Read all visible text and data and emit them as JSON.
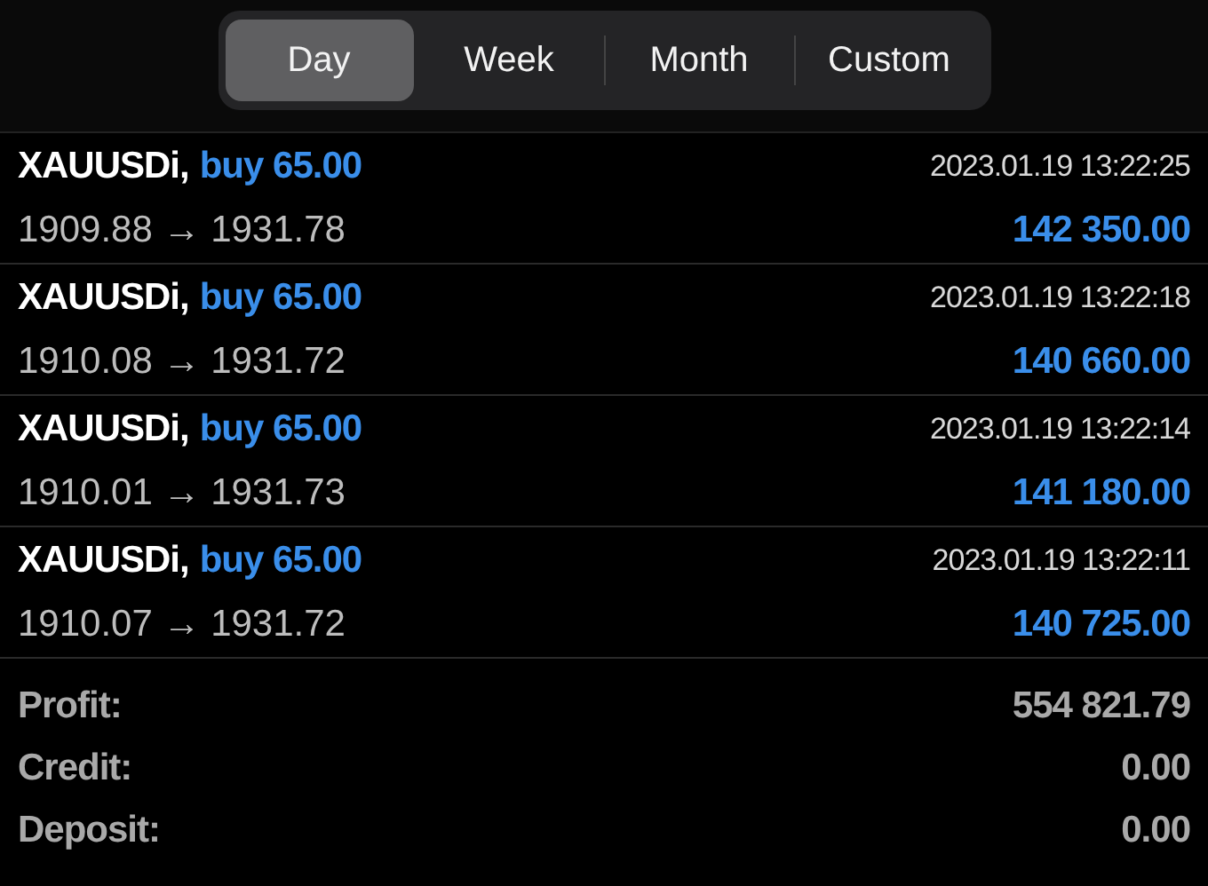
{
  "tabs": [
    {
      "label": "Day",
      "selected": true
    },
    {
      "label": "Week",
      "selected": false
    },
    {
      "label": "Month",
      "selected": false
    },
    {
      "label": "Custom",
      "selected": false
    }
  ],
  "deals": [
    {
      "symbol": "XAUUSDi,",
      "side": "buy 65.00",
      "time": "2023.01.19 13:22:25",
      "prices": "1909.88 → 1931.78",
      "profit": "142 350.00"
    },
    {
      "symbol": "XAUUSDi,",
      "side": "buy 65.00",
      "time": "2023.01.19 13:22:18",
      "prices": "1910.08 → 1931.72",
      "profit": "140 660.00"
    },
    {
      "symbol": "XAUUSDi,",
      "side": "buy 65.00",
      "time": "2023.01.19 13:22:14",
      "prices": "1910.01 → 1931.73",
      "profit": "141 180.00"
    },
    {
      "symbol": "XAUUSDi,",
      "side": "buy 65.00",
      "time": "2023.01.19 13:22:11",
      "prices": "1910.07 → 1931.72",
      "profit": "140 725.00"
    }
  ],
  "summary": [
    {
      "label": "Profit:",
      "value": "554 821.79"
    },
    {
      "label": "Credit:",
      "value": "0.00"
    },
    {
      "label": "Deposit:",
      "value": "0.00"
    }
  ]
}
